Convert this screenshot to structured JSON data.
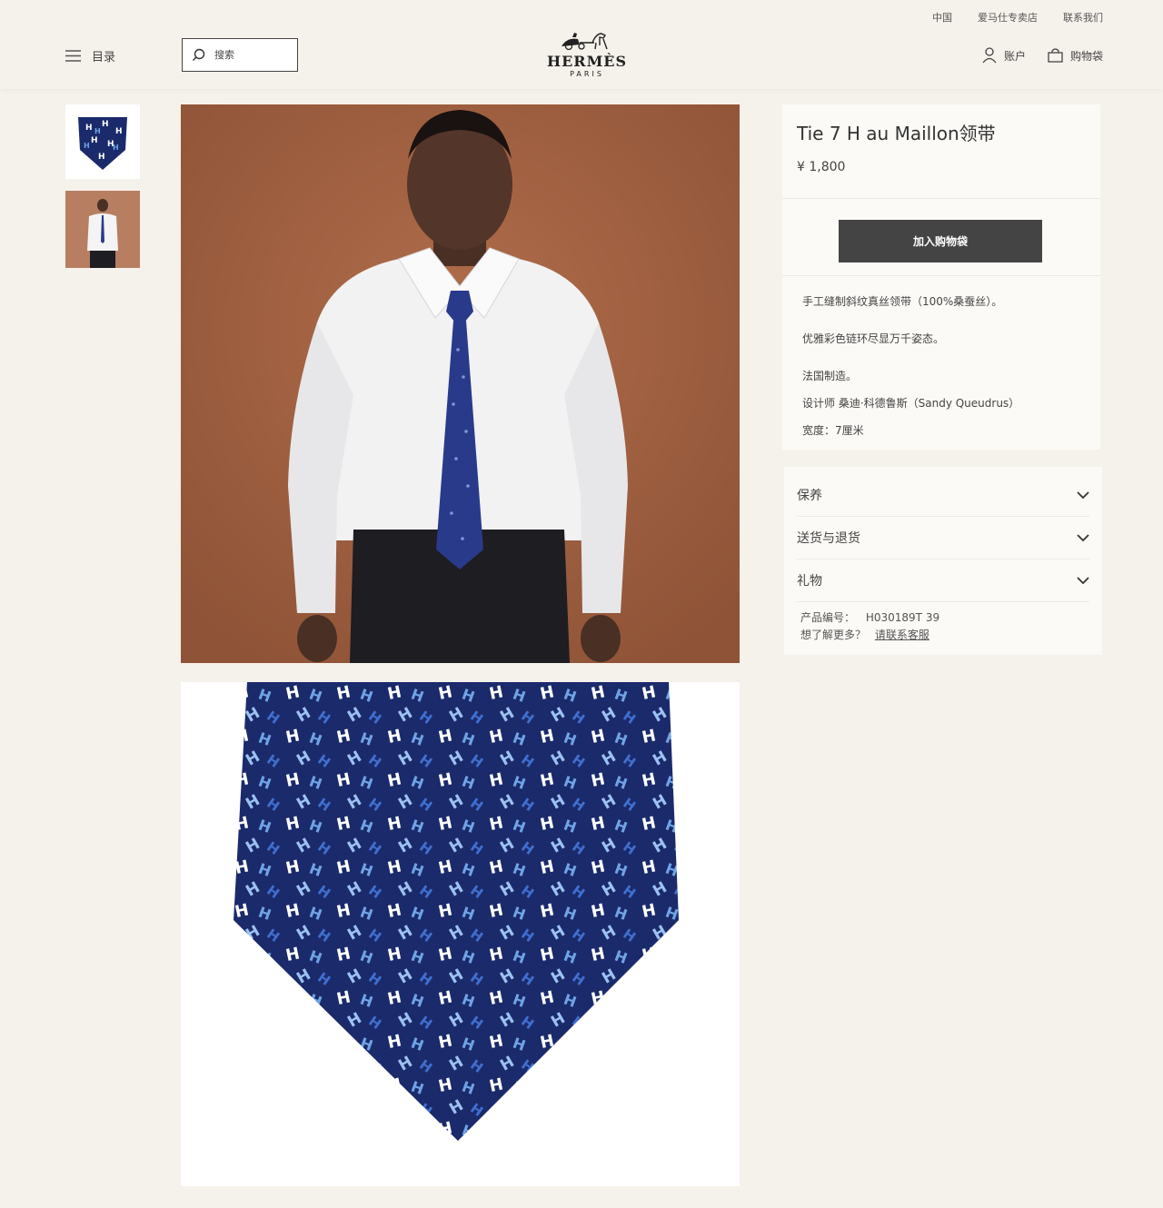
{
  "header": {
    "top_links": [
      "中国",
      "爱马仕专卖店",
      "联系我们"
    ],
    "menu_label": "目录",
    "search_placeholder": "搜索",
    "logo_brand": "HERMÈS",
    "logo_city": "PARIS",
    "account_label": "账户",
    "bag_label": "购物袋"
  },
  "product": {
    "title": "Tie 7 H au Maillon领带",
    "price": "¥ 1,800",
    "add_to_bag": "加入购物袋",
    "description": [
      "手工缝制斜纹真丝领带（100%桑蚕丝）。",
      "优雅彩色链环尽显万千姿态。",
      "法国制造。",
      "设计师 桑迪·科德鲁斯（Sandy Queudrus）",
      "宽度：7厘米"
    ],
    "accordion": [
      "保养",
      "送货与退货",
      "礼物"
    ],
    "sku_label": "产品编号：",
    "sku_value": "H030189T 39",
    "more_info": "想了解更多？",
    "contact_link": "请联系客服"
  },
  "colors": {
    "background": "#f5f1eb",
    "button": "#444444",
    "tie_navy": "#1b2a6b",
    "photo_backdrop": "#a5623f"
  }
}
